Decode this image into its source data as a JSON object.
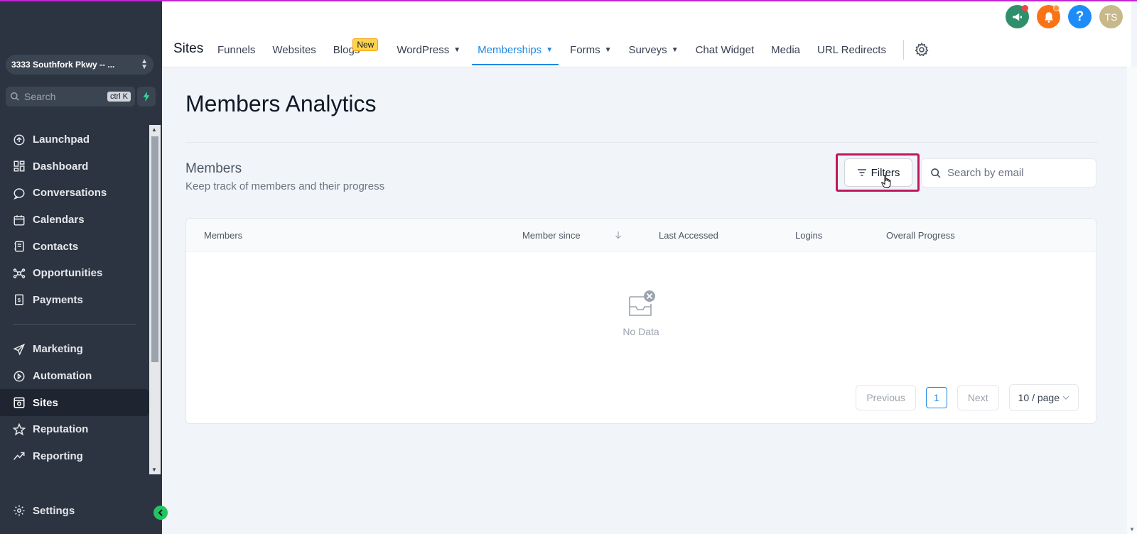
{
  "account": {
    "name": "3333 Southfork Pkwy -- ..."
  },
  "sidebar_search": {
    "placeholder": "Search",
    "shortcut": "ctrl K"
  },
  "sidebar": {
    "items_top": [
      {
        "label": "Launchpad",
        "icon": "launchpad-icon"
      },
      {
        "label": "Dashboard",
        "icon": "dashboard-icon"
      },
      {
        "label": "Conversations",
        "icon": "chat-icon"
      },
      {
        "label": "Calendars",
        "icon": "calendar-icon"
      },
      {
        "label": "Contacts",
        "icon": "contacts-icon"
      },
      {
        "label": "Opportunities",
        "icon": "opportunities-icon"
      },
      {
        "label": "Payments",
        "icon": "payments-icon"
      }
    ],
    "items_bottom": [
      {
        "label": "Marketing",
        "icon": "send-icon"
      },
      {
        "label": "Automation",
        "icon": "automation-icon"
      },
      {
        "label": "Sites",
        "icon": "sites-icon",
        "active": true
      },
      {
        "label": "Reputation",
        "icon": "star-icon"
      },
      {
        "label": "Reporting",
        "icon": "trend-icon"
      }
    ],
    "settings_label": "Settings"
  },
  "header": {
    "title": "Sites",
    "tabs": [
      {
        "label": "Funnels"
      },
      {
        "label": "Websites"
      },
      {
        "label": "Blogs",
        "badge": "New"
      },
      {
        "label": "WordPress",
        "dropdown": true
      },
      {
        "label": "Memberships",
        "dropdown": true,
        "active": true
      },
      {
        "label": "Forms",
        "dropdown": true
      },
      {
        "label": "Surveys",
        "dropdown": true
      },
      {
        "label": "Chat Widget"
      },
      {
        "label": "Media"
      },
      {
        "label": "URL Redirects"
      }
    ],
    "avatar_initials": "TS"
  },
  "colors": {
    "accent": "#1e88e5",
    "sidebar_bg": "#2b3440",
    "highlight": "#be185d",
    "new_badge": "#fcd34d"
  },
  "main": {
    "page_title": "Members Analytics",
    "section_title": "Members",
    "section_subtitle": "Keep track of members and their progress",
    "filters_label": "Filters",
    "search_placeholder": "Search by email",
    "columns": [
      "Members",
      "Member since",
      "Last Accessed",
      "Logins",
      "Overall Progress"
    ],
    "empty_text": "No Data",
    "pagination": {
      "prev": "Previous",
      "page": "1",
      "next": "Next",
      "page_size": "10 / page"
    }
  }
}
